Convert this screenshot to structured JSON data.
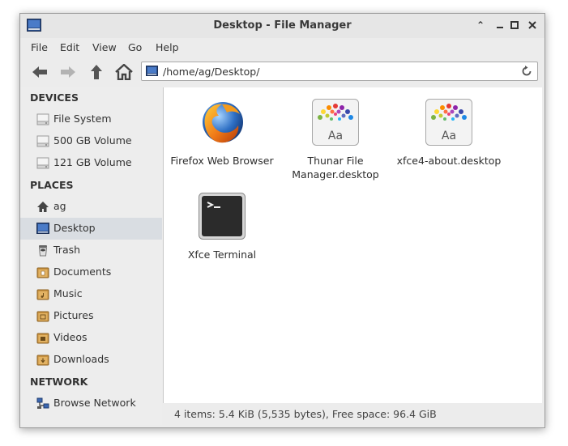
{
  "window": {
    "title": "Desktop - File Manager"
  },
  "menu": [
    "File",
    "Edit",
    "View",
    "Go",
    "Help"
  ],
  "location": {
    "path": "/home/ag/Desktop/"
  },
  "sidebar": {
    "devices_header": "DEVICES",
    "devices": [
      {
        "label": "File System",
        "icon": "drive-icon"
      },
      {
        "label": "500 GB Volume",
        "icon": "drive-icon"
      },
      {
        "label": "121 GB Volume",
        "icon": "drive-icon"
      }
    ],
    "places_header": "PLACES",
    "places": [
      {
        "label": "ag",
        "icon": "home-icon"
      },
      {
        "label": "Desktop",
        "icon": "desktop-icon",
        "selected": true
      },
      {
        "label": "Trash",
        "icon": "trash-icon"
      },
      {
        "label": "Documents",
        "icon": "folder-icon"
      },
      {
        "label": "Music",
        "icon": "folder-icon"
      },
      {
        "label": "Pictures",
        "icon": "folder-icon"
      },
      {
        "label": "Videos",
        "icon": "folder-icon"
      },
      {
        "label": "Downloads",
        "icon": "folder-icon"
      }
    ],
    "network_header": "NETWORK",
    "network": [
      {
        "label": "Browse Network",
        "icon": "network-icon"
      }
    ]
  },
  "files": [
    {
      "label": "Firefox Web Browser",
      "icon": "firefox-icon"
    },
    {
      "label": "Thunar File Manager.desktop",
      "icon": "font-desktop-icon"
    },
    {
      "label": "xfce4-about.desktop",
      "icon": "font-desktop-icon"
    },
    {
      "label": "Xfce Terminal",
      "icon": "terminal-icon"
    }
  ],
  "status": {
    "text": "4 items: 5.4 KiB (5,535 bytes), Free space: 96.4 GiB"
  },
  "colors": {
    "selection": "#d9dde2",
    "sidebar_bg": "#ededed",
    "window_bg": "#ececec"
  }
}
